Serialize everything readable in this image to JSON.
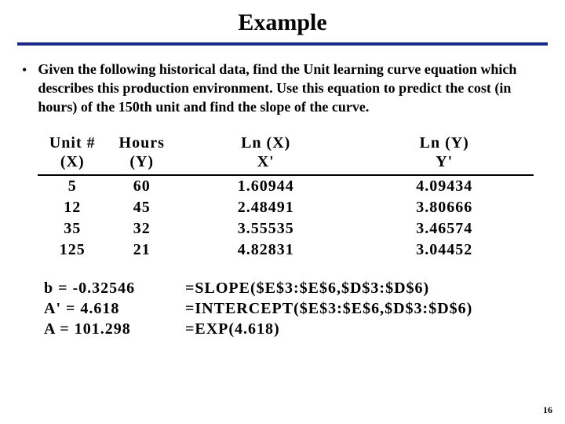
{
  "title": "Example",
  "bullet": "Given the following historical data, find the Unit learning curve equation which describes this production environment.  Use this equation to predict the cost (in hours) of the 150th unit and find the slope of the curve.",
  "table": {
    "headers": {
      "unit_l1": "Unit #",
      "unit_l2": "(X)",
      "hours_l1": "Hours",
      "hours_l2": "(Y)",
      "lnx_l1": "Ln (X)",
      "lnx_l2": "X'",
      "lny_l1": "Ln (Y)",
      "lny_l2": "Y'"
    },
    "rows": [
      {
        "x": "5",
        "y": "60",
        "lnx": "1.60944",
        "lny": "4.09434"
      },
      {
        "x": "12",
        "y": "45",
        "lnx": "2.48491",
        "lny": "3.80666"
      },
      {
        "x": "35",
        "y": "32",
        "lnx": "3.55535",
        "lny": "3.46574"
      },
      {
        "x": "125",
        "y": "21",
        "lnx": "4.82831",
        "lny": "3.04452"
      }
    ]
  },
  "calc": {
    "b": "b = -0.32546",
    "aprime": "A' = 4.618",
    "a": "A = 101.298",
    "slope": "=SLOPE($E$3:$E$6,$D$3:$D$6)",
    "intercept": "=INTERCEPT($E$3:$E$6,$D$3:$D$6)",
    "exp": "=EXP(4.618)"
  },
  "page_number": "16",
  "chart_data": {
    "type": "table",
    "title": "Example",
    "columns": [
      "Unit # (X)",
      "Hours (Y)",
      "Ln (X) X'",
      "Ln (Y) Y'"
    ],
    "rows": [
      [
        5,
        60,
        1.60944,
        4.09434
      ],
      [
        12,
        45,
        2.48491,
        3.80666
      ],
      [
        35,
        32,
        3.55535,
        3.46574
      ],
      [
        125,
        21,
        4.82831,
        3.04452
      ]
    ],
    "derived": {
      "b": -0.32546,
      "A_prime": 4.618,
      "A": 101.298
    }
  }
}
